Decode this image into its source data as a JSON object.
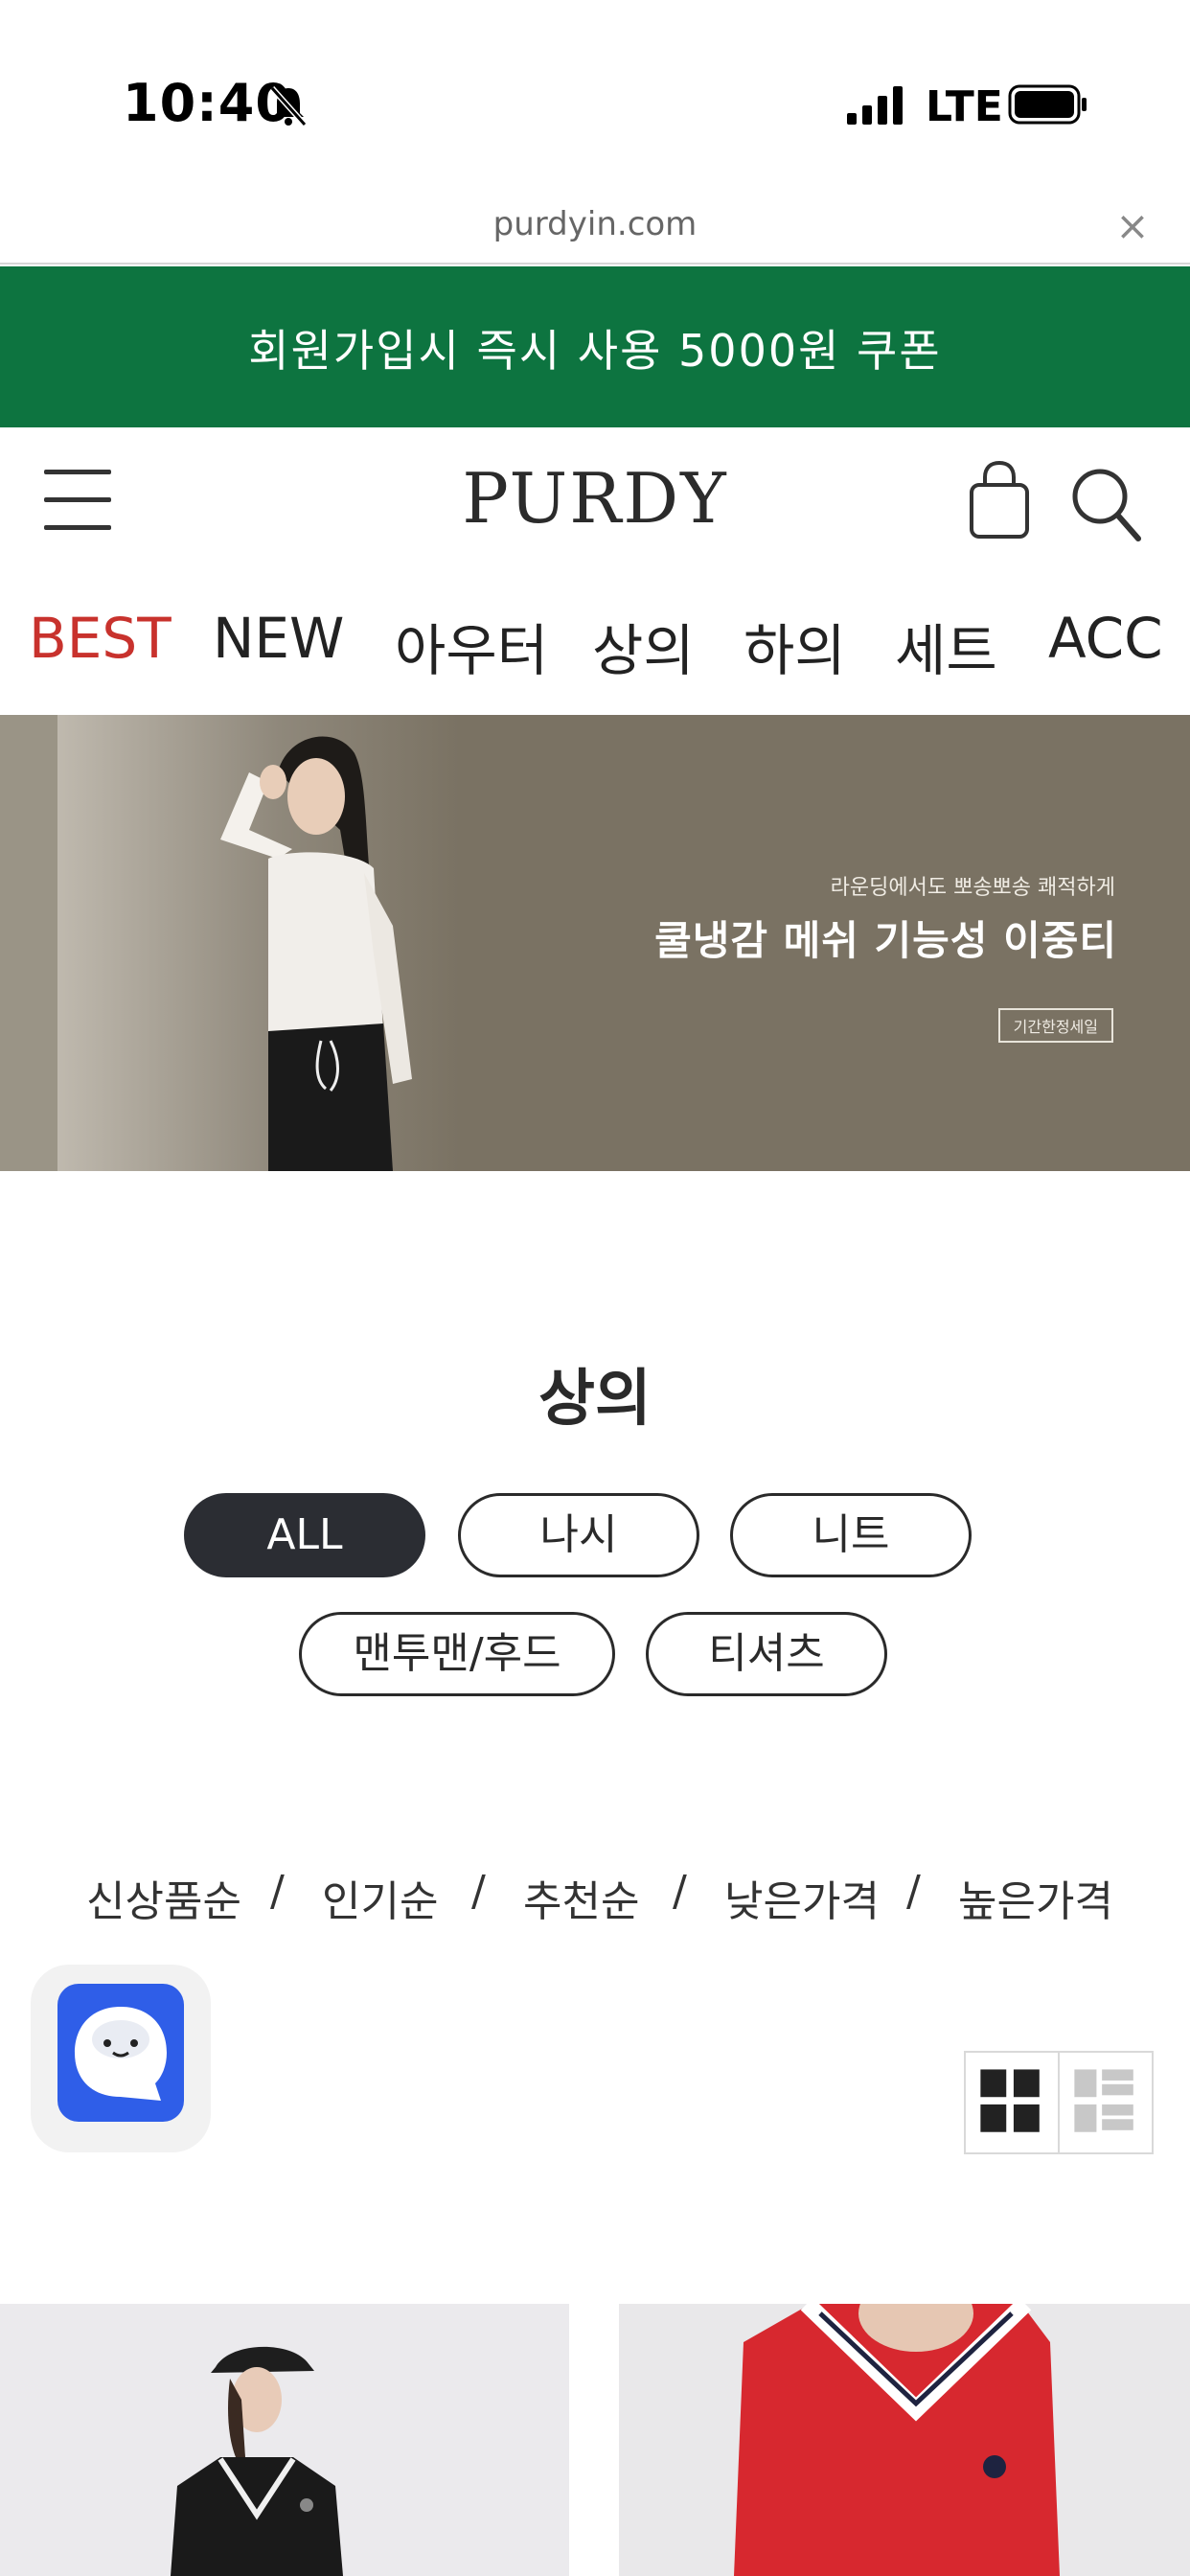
{
  "status_bar": {
    "time": "10:40",
    "network": "LTE",
    "icons": [
      "bell-slash-icon",
      "signal-icon",
      "battery-icon"
    ]
  },
  "browser": {
    "url": "purdyin.com",
    "close_icon": "close-icon"
  },
  "promo": {
    "text": "회원가입시 즉시 사용 5000원 쿠폰",
    "color": "#0d7440"
  },
  "header": {
    "logo": "PURDY",
    "icons": [
      "menu-icon",
      "shopping-bag-icon",
      "search-icon"
    ]
  },
  "categories": [
    {
      "label": "BEST",
      "active": true
    },
    {
      "label": "NEW"
    },
    {
      "label": "아우터"
    },
    {
      "label": "상의"
    },
    {
      "label": "하의"
    },
    {
      "label": "세트"
    },
    {
      "label": "ACC"
    }
  ],
  "hero": {
    "subtitle": "라운딩에서도 뽀송뽀송 쾌적하게",
    "title": "쿨냉감 메쉬 기능성 이중티",
    "badge": "기간한정세일"
  },
  "section": {
    "title": "상의",
    "filters": [
      {
        "label": "ALL",
        "active": true
      },
      {
        "label": "나시"
      },
      {
        "label": "니트"
      },
      {
        "label": "맨투맨/후드"
      },
      {
        "label": "티셔츠"
      }
    ]
  },
  "sort": {
    "options": [
      "신상품순",
      "인기순",
      "추천순",
      "낮은가격",
      "높은가격"
    ],
    "separator": "/"
  },
  "view_toggle": {
    "icons": [
      "grid-2-icon",
      "list-grid-icon"
    ]
  },
  "accent_colors": {
    "best": "#c8322d",
    "active_pill": "#2b2d33",
    "chat": "#2f5ee8"
  }
}
